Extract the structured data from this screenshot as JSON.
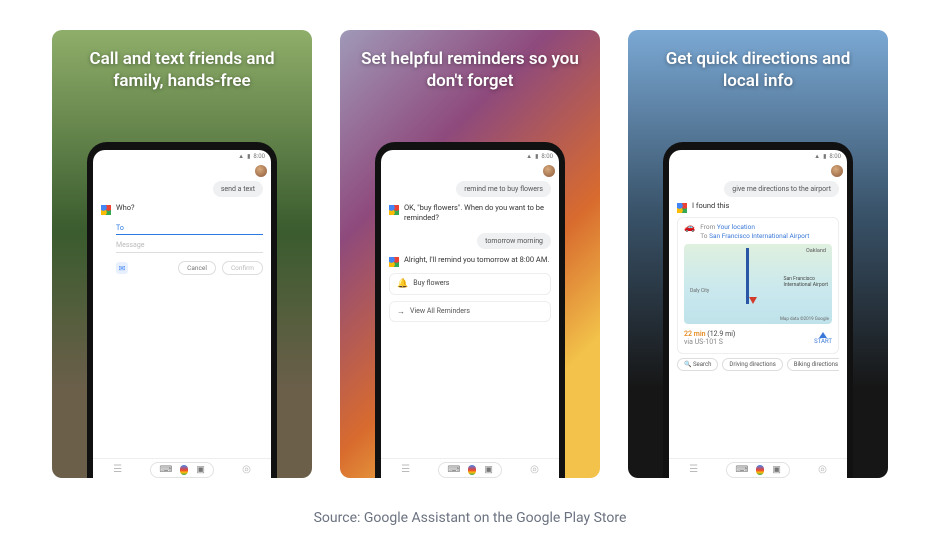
{
  "source_caption": "Source: Google Assistant on the Google Play Store",
  "status_time": "8:00",
  "panels": [
    {
      "headline": "Call and text friends and family, hands-free",
      "user_message": "send a text",
      "assistant_prompt": "Who?",
      "to_label": "To",
      "message_placeholder": "Message",
      "cancel_label": "Cancel",
      "confirm_label": "Confirm"
    },
    {
      "headline": "Set helpful reminders so you don't forget",
      "user_message_1": "remind me to buy flowers",
      "assistant_reply_1": "OK, \"buy flowers\". When do you want to be reminded?",
      "user_message_2": "tomorrow morning",
      "assistant_reply_2": "Alright, I'll remind you tomorrow at 8:00 AM.",
      "reminder_title": "Buy flowers",
      "view_all_label": "View All Reminders"
    },
    {
      "headline": "Get quick directions and local info",
      "user_message": "give me directions to the airport",
      "assistant_reply": "I found this",
      "from_label": "From",
      "from_value": "Your location",
      "to_label": "To",
      "to_value": "San Francisco International Airport",
      "map_city_right": "Oakland",
      "map_city_left": "Daly City",
      "map_poi_line1": "San Francisco",
      "map_poi_line2": "International Airport",
      "map_attr": "Map data ©2019 Google",
      "eta_time": "22 min",
      "eta_distance": "(12.9 mi)",
      "eta_route": "via US-101 S",
      "start_label": "START",
      "chips": [
        "Search",
        "Driving directions",
        "Biking directions"
      ]
    }
  ]
}
